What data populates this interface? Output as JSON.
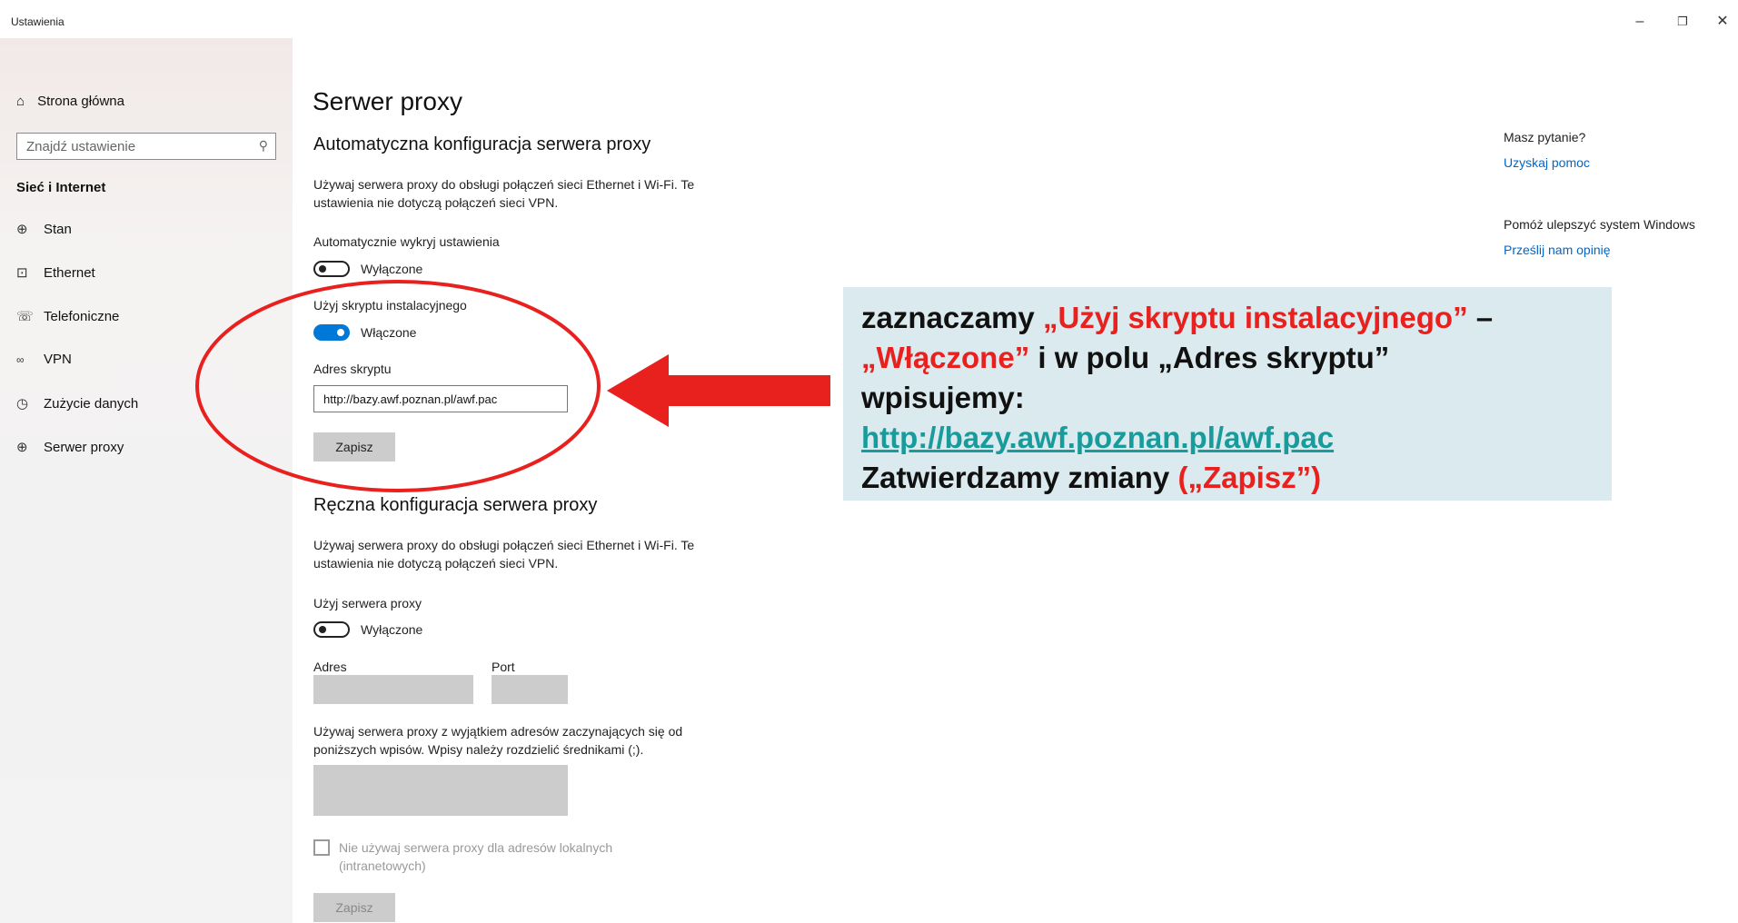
{
  "window": {
    "title": "Ustawienia",
    "minimize": "–",
    "restore": "❐",
    "close": "✕"
  },
  "sidebar": {
    "home_label": "Strona główna",
    "search_placeholder": "Znajdź ustawienie",
    "section_title": "Sieć i Internet",
    "items": [
      {
        "label": "Stan",
        "icon": "globe-icon"
      },
      {
        "label": "Ethernet",
        "icon": "ethernet-icon"
      },
      {
        "label": "Telefoniczne",
        "icon": "dialup-icon"
      },
      {
        "label": "VPN",
        "icon": "vpn-icon"
      },
      {
        "label": "Zużycie danych",
        "icon": "data-usage-icon"
      },
      {
        "label": "Serwer proxy",
        "icon": "globe-icon"
      }
    ]
  },
  "main": {
    "page_title": "Serwer proxy",
    "auto": {
      "heading": "Automatyczna konfiguracja serwera proxy",
      "description": "Używaj serwera proxy do obsługi połączeń sieci Ethernet i Wi-Fi. Te ustawienia nie dotyczą połączeń sieci VPN.",
      "detect_label": "Automatycznie wykryj ustawienia",
      "detect_state": "Wyłączone",
      "script_label": "Użyj skryptu instalacyjnego",
      "script_state": "Włączone",
      "address_label": "Adres skryptu",
      "address_value": "http://bazy.awf.poznan.pl/awf.pac",
      "save_label": "Zapisz"
    },
    "manual": {
      "heading": "Ręczna konfiguracja serwera proxy",
      "description": "Używaj serwera proxy do obsługi połączeń sieci Ethernet i Wi-Fi. Te ustawienia nie dotyczą połączeń sieci VPN.",
      "use_proxy_label": "Użyj serwera proxy",
      "use_proxy_state": "Wyłączone",
      "address_label": "Adres",
      "port_label": "Port",
      "exceptions_text": "Używaj serwera proxy z wyjątkiem adresów zaczynających się od poniższych wpisów. Wpisy należy rozdzielić średnikami (;).",
      "local_checkbox_label": "Nie używaj serwera proxy dla adresów lokalnych (intranetowych)",
      "save_label": "Zapisz"
    }
  },
  "right_panel": {
    "question": "Masz pytanie?",
    "help_link": "Uzyskaj pomoc",
    "improve": "Pomóż ulepszyć system Windows",
    "feedback_link": "Prześlij nam opinię"
  },
  "callout": {
    "part1": "zaznaczamy ",
    "part2": "„Użyj skryptu  instalacyjnego”",
    "part3": " –",
    "part4": "„Włączone”",
    "part5": " i w polu „Adres skryptu”",
    "part6": "wpisujemy:",
    "url": "http://bazy.awf.poznan.pl/awf.pac",
    "part7": "Zatwierdzamy zmiany ",
    "part8": "(„Zapisz”)"
  },
  "colors": {
    "accent": "#0078d7",
    "annotation_red": "#e8201e",
    "callout_bg": "#dbeaee",
    "link": "#0066cc"
  }
}
